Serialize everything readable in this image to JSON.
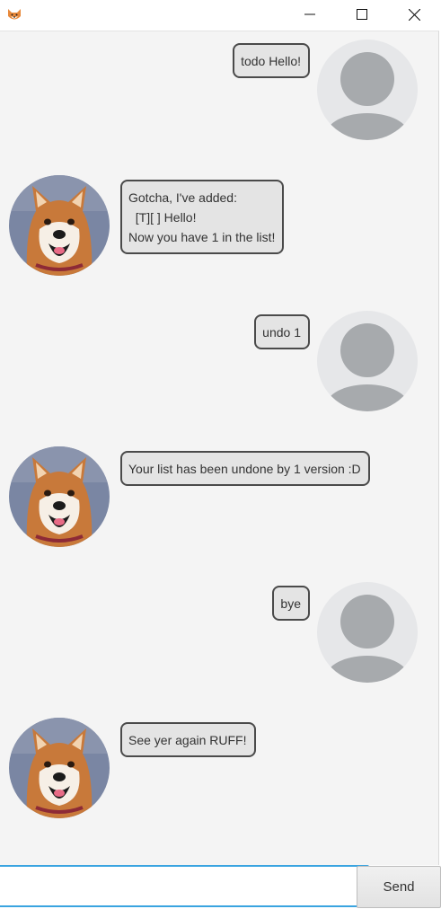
{
  "window": {
    "app_icon": "shiba-dog-icon",
    "controls": [
      "minimize-icon",
      "maximize-icon",
      "close-icon"
    ]
  },
  "messages": [
    {
      "sender": "user",
      "text": "todo Hello!"
    },
    {
      "sender": "bot",
      "text": "Gotcha, I've added:\n  [T][ ] Hello!\nNow you have 1 in the list!"
    },
    {
      "sender": "user",
      "text": "undo 1"
    },
    {
      "sender": "bot",
      "text": "Your list has been undone by 1 version :D"
    },
    {
      "sender": "user",
      "text": "bye"
    },
    {
      "sender": "bot",
      "text": "See yer again RUFF!"
    }
  ],
  "input": {
    "value": "",
    "placeholder": ""
  },
  "send_label": "Send",
  "colors": {
    "chat_background": "#f4f4f4",
    "bubble_fill": "#e4e4e4",
    "bubble_border": "#4a4a4a",
    "input_focus_border": "#3aa4e0",
    "user_avatar_bg": "#e6e7e9",
    "user_avatar_figure": "#a7aaad"
  }
}
